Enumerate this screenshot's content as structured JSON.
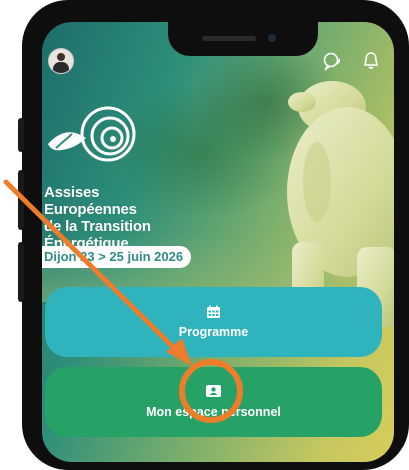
{
  "header": {
    "avatar_label": "avatar",
    "icons": [
      "chat-icon",
      "bell-icon"
    ]
  },
  "hero": {
    "title_lines": [
      "Assises",
      "Européennes",
      "de la Transition",
      "Énergétique"
    ],
    "date": "Dijon 23 > 25 juin 2026"
  },
  "menu": {
    "items": [
      {
        "label": "Programme",
        "icon": "calendar-icon",
        "color": "#2fb4bd"
      },
      {
        "label": "Mon espace personnel",
        "icon": "profile-card-icon",
        "color": "#27a266"
      }
    ]
  },
  "annotation": {
    "color": "#ee7d2b"
  }
}
